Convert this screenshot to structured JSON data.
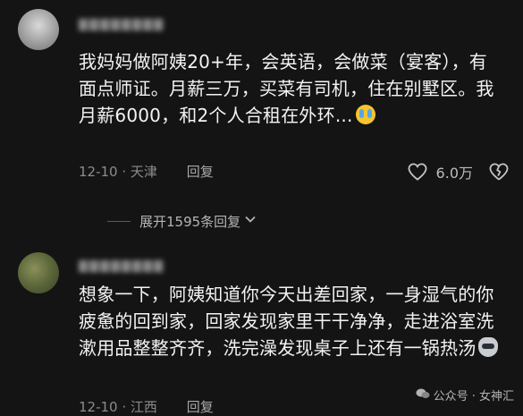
{
  "comment1": {
    "text": "我妈妈做阿姨20+年，会英语，会做菜（宴客），有面点师证。月薪三万，买菜有司机，住在别墅区。我月薪6000，和2个人合租在外环...",
    "date_location": "12-10 · 天津",
    "reply_label": "回复",
    "like_count": "6.0万"
  },
  "expand_replies": {
    "label": "展开1595条回复"
  },
  "comment2": {
    "text": "想象一下，阿姨知道你今天出差回家，一身湿气的你疲惫的回到家，回家发现家里干干净净，走进浴室洗漱用品整整齐齐，洗完澡发现桌子上还有一锅热汤",
    "date_location": "12-10 · 江西",
    "reply_label": "回复"
  },
  "watermark": {
    "text": "公众号 · 女神汇"
  },
  "icons": {
    "like": "heart-outline-icon",
    "dislike": "broken-heart-icon",
    "expand": "chevron-down-icon",
    "emoji1": "crying-face-emoji-icon",
    "emoji2": "wolf-emoji-icon",
    "watermark": "wechat-icon"
  },
  "colors": {
    "background": "#141414",
    "text": "#f3f3f3",
    "meta": "#8c8c8c"
  }
}
